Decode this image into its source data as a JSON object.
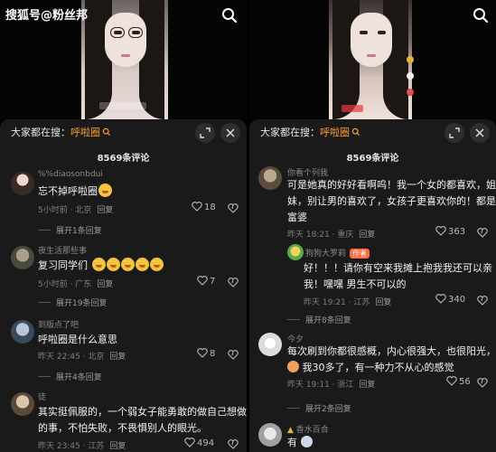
{
  "watermark": "搜狐号@粉丝邦",
  "left": {
    "search_prefix": "大家都在搜：",
    "search_query": "呼啦圈",
    "comment_count": "8569条评论",
    "comments": [
      {
        "user": "%%diaosonbdui",
        "text": "忘不掉呼啦圈",
        "time": "5小时前 · 北京",
        "reply": "回复",
        "likes": "18"
      },
      {
        "expand": "展开1条回复"
      },
      {
        "user": "夜生活那些事",
        "text": "复习同学们",
        "time": "5小时前 · 广东",
        "reply": "回复",
        "likes": "7"
      },
      {
        "expand": "展开19条回复"
      },
      {
        "user": "到版点了吧",
        "text": "呼啦圈是什么意思",
        "time": "昨天 22:45 · 北京",
        "reply": "回复",
        "likes": "8"
      },
      {
        "expand": "展开4条回复"
      },
      {
        "user": "徒",
        "text1": "其实挺佩服的，一个弱女子能勇敢的做自己想做",
        "text2": "的事，不怕失败，不畏惧别人的眼光。",
        "time": "昨天 23:45 · 江苏",
        "reply": "回复",
        "likes": "494"
      }
    ]
  },
  "right": {
    "search_prefix": "大家都在搜：",
    "search_query": "呼啦圈",
    "comment_count": "8569条评论",
    "comments": [
      {
        "user": "你看个列我",
        "text1": "可是她真的好好看啊呜！我一个女的都喜欢，姐",
        "text2": "妹，别让男的喜欢了，女孩子更喜欢你的！都是",
        "text3": "富婆",
        "time": "昨天 18:21 · 重庆",
        "reply": "回复",
        "likes": "363"
      },
      {
        "user": "狗狗大罗莉",
        "author_tag": "作者",
        "text1": "好！！！请你有空来我摊上抱我我还可以亲",
        "text2": "我！嘿嘿 男生不可以的",
        "time": "昨天 19:21 · 江苏",
        "reply": "回复",
        "likes": "340"
      },
      {
        "expand": "展开8条回复"
      },
      {
        "user": "今夕",
        "text1": "每次刷到你都很感概，内心很强大，也很阳光，",
        "text2": "我30多了，有一种力不从心的感觉",
        "time": "昨天 19:11 · 浙江",
        "reply": "回复",
        "likes": "56"
      },
      {
        "expand": "展开2条回复"
      },
      {
        "user": "香水百合",
        "text": "有"
      }
    ]
  },
  "colors": {
    "accent": "#ff9d2e",
    "sheet_bg": "#1a1a1a",
    "author_tag": "#ff6b3d"
  }
}
